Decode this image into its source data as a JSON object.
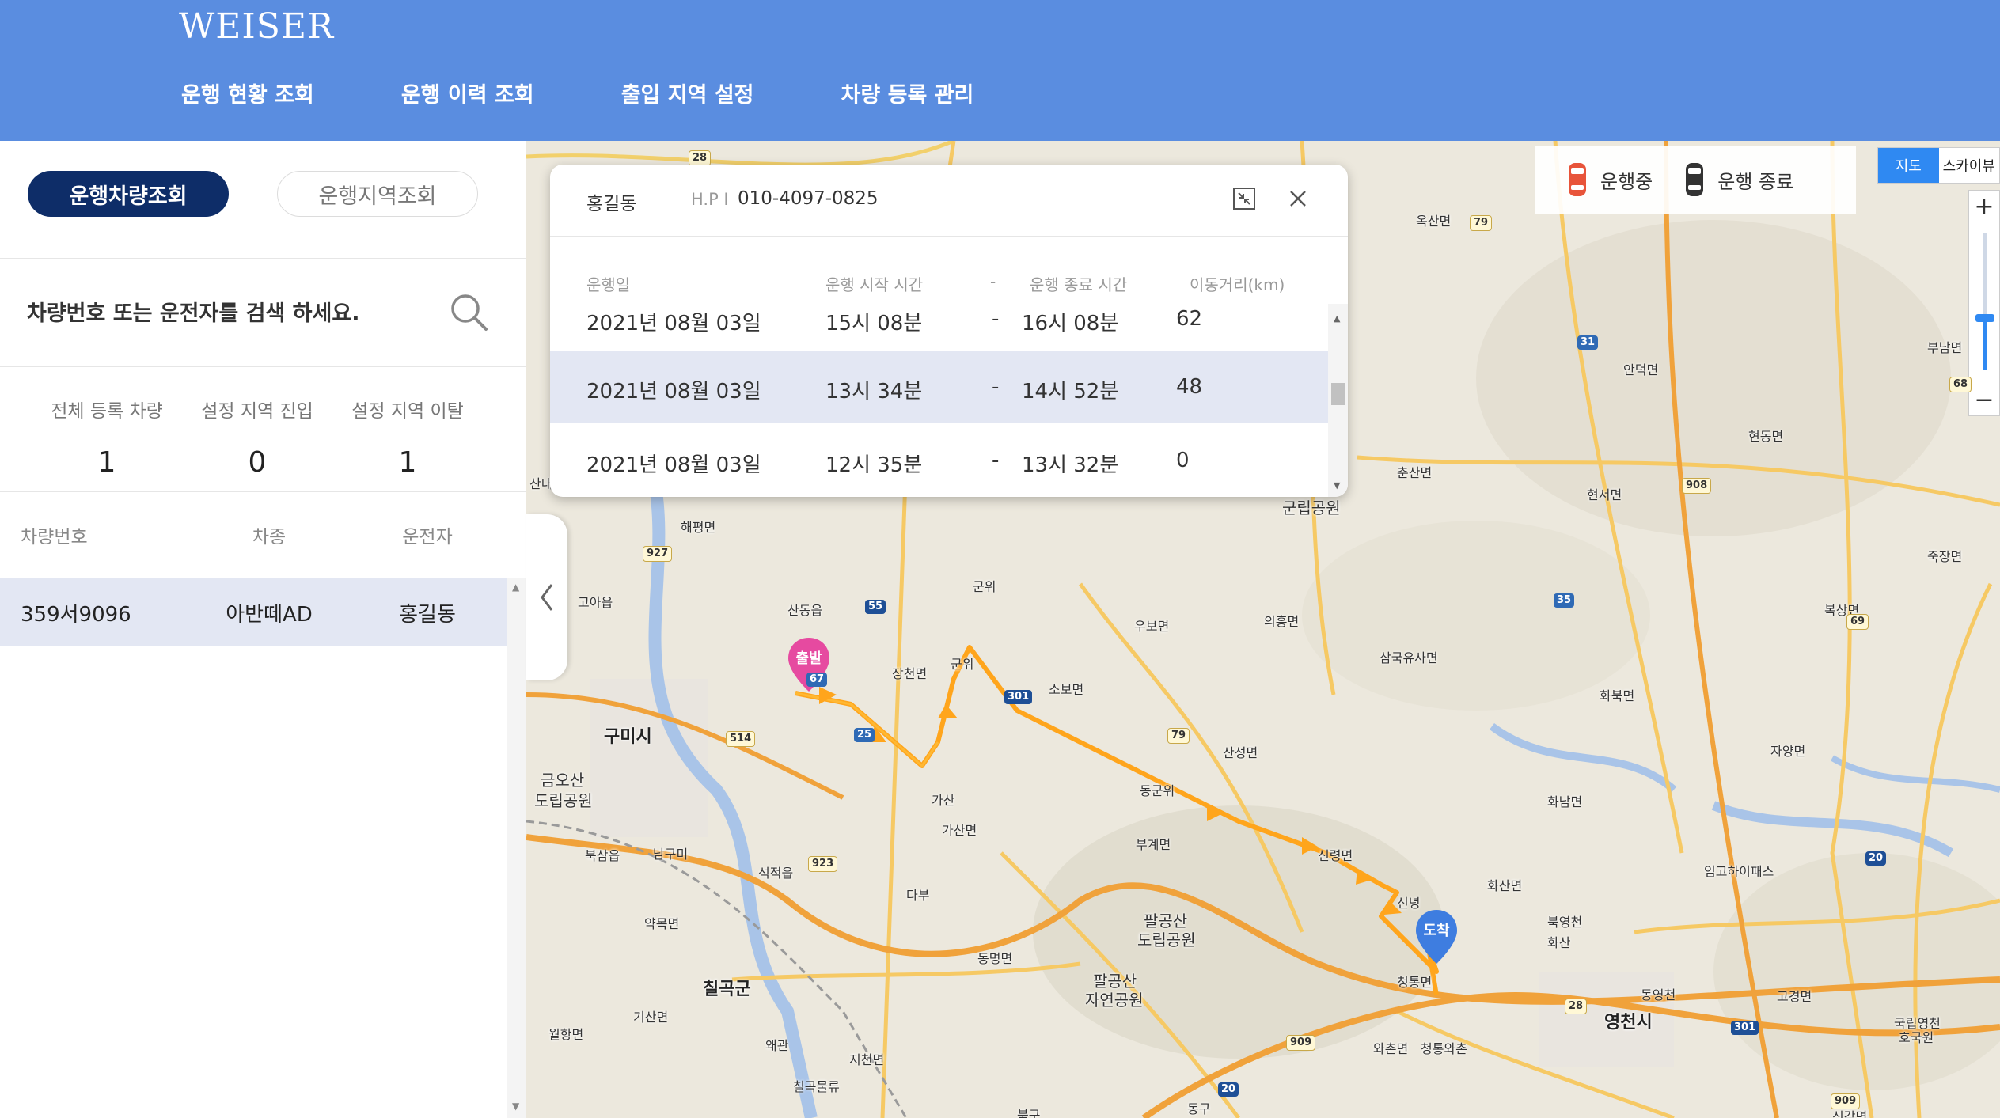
{
  "header": {
    "logo": "WEISER",
    "nav": [
      "운행 현황 조회",
      "운행 이력 조회",
      "출입 지역 설정",
      "차량 등록 관리"
    ]
  },
  "left": {
    "tab_vehicle": "운행차량조회",
    "tab_region": "운행지역조회",
    "search_placeholder": "차량번호 또는 운전자를 검색 하세요.",
    "stats": [
      {
        "label": "전체 등록 차량",
        "value": "1"
      },
      {
        "label": "설정 지역 진입",
        "value": "0"
      },
      {
        "label": "설정 지역 이탈",
        "value": "1"
      }
    ],
    "table_headers": [
      "차량번호",
      "차종",
      "운전자"
    ],
    "rows": [
      {
        "plate": "359서9096",
        "model": "아반떼AD",
        "driver": "홍길동"
      }
    ]
  },
  "map": {
    "legend_running": "운행중",
    "legend_ended": "운행 종료",
    "type_map": "지도",
    "type_sky": "스카이뷰",
    "zoom_in": "+",
    "zoom_out": "−",
    "marker_start": "출발",
    "marker_end": "도착",
    "labels": [
      "구미시",
      "금오산",
      "도립공원",
      "북삼읍",
      "남구미",
      "석적읍",
      "약목면",
      "칠곡군",
      "기산면",
      "월항면",
      "왜관",
      "지천면",
      "칠곡물류",
      "고아읍",
      "해평면",
      "산동읍",
      "장천면",
      "군위",
      "군위",
      "소보면",
      "우보면",
      "의흥면",
      "가산",
      "가산면",
      "다부",
      "동명면",
      "팔공산",
      "도립공원",
      "팔공산",
      "자연공원",
      "부계면",
      "동군위",
      "산성면",
      "삼국유사면",
      "신령면",
      "신녕",
      "화산면",
      "청통면",
      "와촌면",
      "청통와촌",
      "영천시",
      "화남면",
      "북영천",
      "화북면",
      "자양면",
      "고경면",
      "동영천",
      "임고하이패스",
      "국립영천",
      "호국원",
      "현서면",
      "안덕면",
      "현동면",
      "옥산면",
      "춘산면",
      "군립공원",
      "부남면",
      "죽장면",
      "화산",
      "동구",
      "북구",
      "산내",
      "복상면",
      "신감면"
    ],
    "road_numbers": [
      "28",
      "79",
      "927",
      "55",
      "67",
      "25",
      "514",
      "923",
      "301",
      "79",
      "31",
      "908",
      "35",
      "69",
      "68",
      "909",
      "20",
      "28",
      "301",
      "20",
      "909"
    ]
  },
  "popup": {
    "name": "홍길동",
    "hp_label": "H.P I",
    "hp": "010-4097-0825",
    "headers": [
      "운행일",
      "운행 시작 시간",
      "-",
      "운행 종료 시간",
      "이동거리(km)"
    ],
    "rows": [
      {
        "date": "2021년 08월 03일",
        "start": "15시 08분",
        "sep": "-",
        "end": "16시 08분",
        "dist": "62"
      },
      {
        "date": "2021년 08월 03일",
        "start": "13시 34분",
        "sep": "-",
        "end": "14시 52분",
        "dist": "48"
      },
      {
        "date": "2021년 08월 03일",
        "start": "12시 35분",
        "sep": "-",
        "end": "13시 32분",
        "dist": "0"
      }
    ]
  }
}
